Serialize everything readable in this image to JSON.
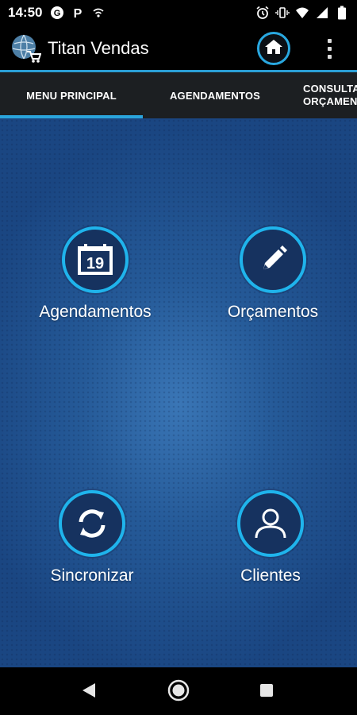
{
  "status_bar": {
    "time": "14:50",
    "left_icons": [
      "notification-circle-icon",
      "parking-icon",
      "wifi-signal-icon"
    ],
    "right_icons": [
      "alarm-icon",
      "vibrate-icon",
      "wifi-icon",
      "cell-signal-icon",
      "battery-icon"
    ]
  },
  "app_bar": {
    "title": "Titan Vendas",
    "logo_icon": "globe-cart-icon",
    "home_icon": "home-icon",
    "overflow_icon": "more-vert-icon"
  },
  "tabs": [
    {
      "label": "MENU PRINCIPAL",
      "selected": true
    },
    {
      "label": "AGENDAMENTOS",
      "selected": false
    },
    {
      "label_line1": "CONSULTA",
      "label_line2": "ORÇAMENTOS",
      "selected": false
    }
  ],
  "menu": [
    {
      "label": "Agendamentos",
      "icon": "calendar-icon",
      "icon_text": "19"
    },
    {
      "label": "Orçamentos",
      "icon": "pencil-icon"
    },
    {
      "label": "Sincronizar",
      "icon": "sync-icon"
    },
    {
      "label": "Clientes",
      "icon": "person-icon"
    }
  ],
  "colors": {
    "accent": "#29a8e0",
    "background_blue": "#255a98",
    "tab_bar": "#1c1f22"
  },
  "nav_bar": {
    "icons": [
      "back-icon",
      "home-circle-icon",
      "recents-icon"
    ]
  }
}
